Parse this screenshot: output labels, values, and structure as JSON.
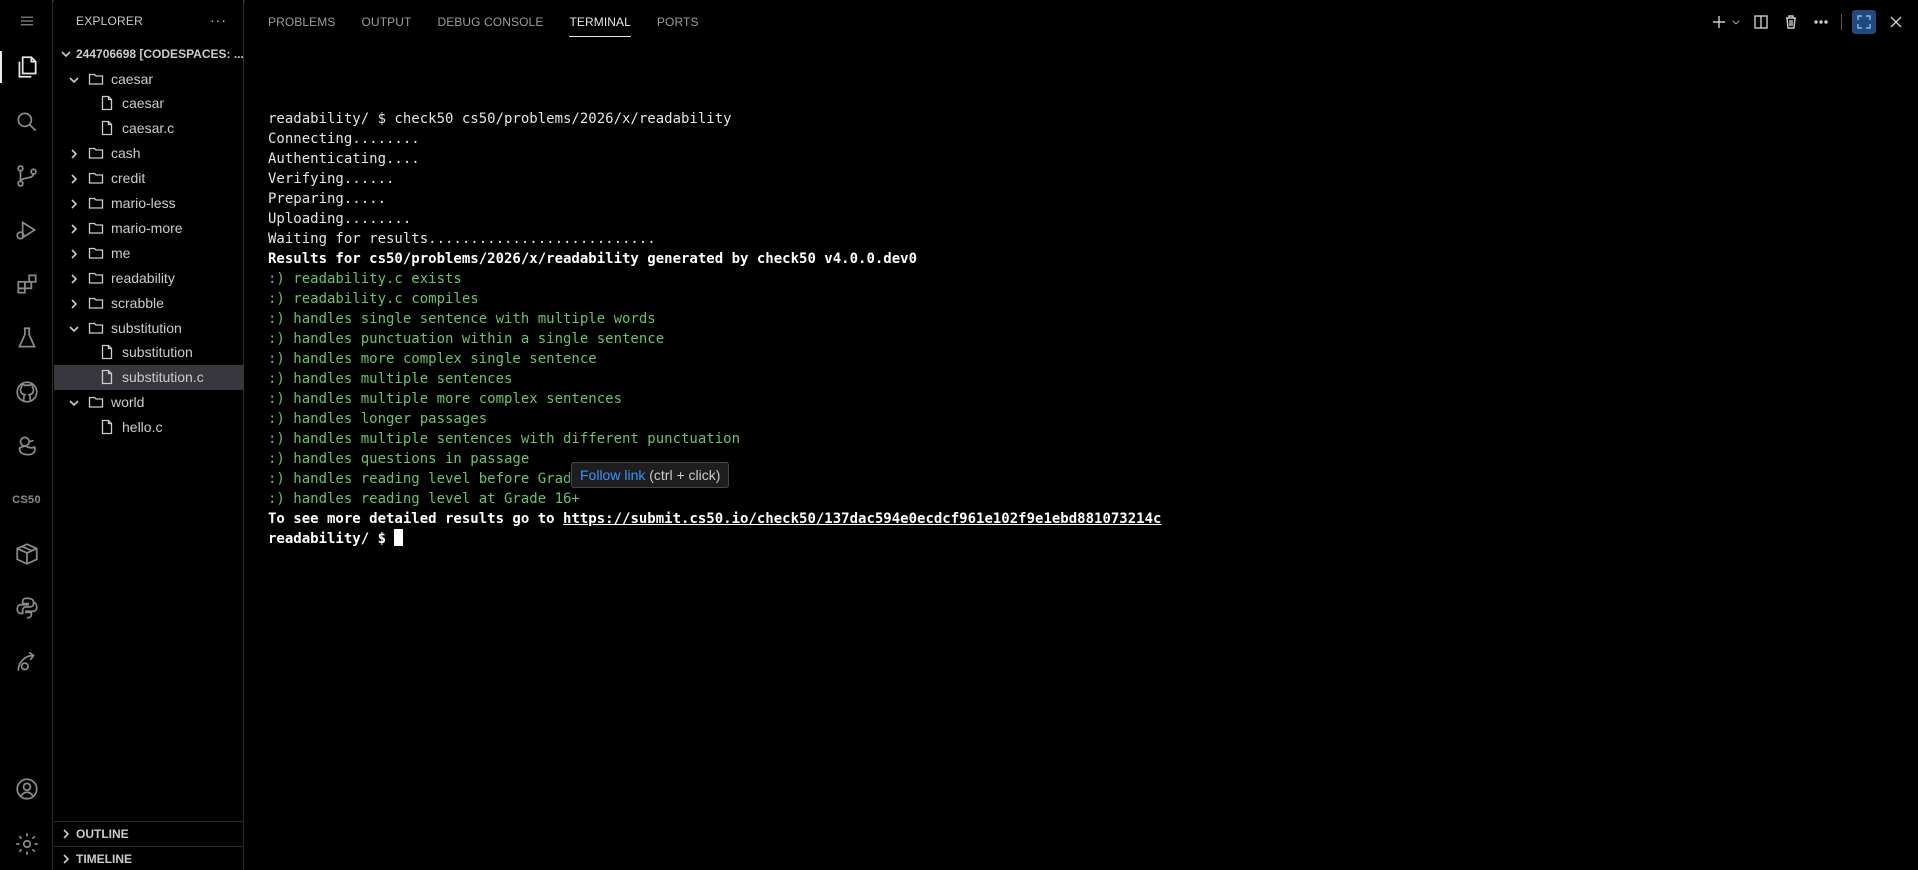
{
  "sidebar": {
    "title": "EXPLORER",
    "more": "···",
    "workspace": "244706698 [CODESPACES: ...",
    "items": [
      {
        "label": "caesar",
        "kind": "folder",
        "open": true,
        "depth": 0
      },
      {
        "label": "caesar",
        "kind": "file",
        "depth": 1
      },
      {
        "label": "caesar.c",
        "kind": "file",
        "depth": 1
      },
      {
        "label": "cash",
        "kind": "folder",
        "open": false,
        "depth": 0
      },
      {
        "label": "credit",
        "kind": "folder",
        "open": false,
        "depth": 0
      },
      {
        "label": "mario-less",
        "kind": "folder",
        "open": false,
        "depth": 0
      },
      {
        "label": "mario-more",
        "kind": "folder",
        "open": false,
        "depth": 0
      },
      {
        "label": "me",
        "kind": "folder",
        "open": false,
        "depth": 0
      },
      {
        "label": "readability",
        "kind": "folder",
        "open": false,
        "depth": 0
      },
      {
        "label": "scrabble",
        "kind": "folder",
        "open": false,
        "depth": 0
      },
      {
        "label": "substitution",
        "kind": "folder",
        "open": true,
        "depth": 0
      },
      {
        "label": "substitution",
        "kind": "file",
        "depth": 1
      },
      {
        "label": "substitution.c",
        "kind": "file",
        "depth": 1,
        "selected": true
      },
      {
        "label": "world",
        "kind": "folder",
        "open": true,
        "depth": 0
      },
      {
        "label": "hello.c",
        "kind": "file",
        "depth": 1
      }
    ],
    "outline": "OUTLINE",
    "timeline": "TIMELINE"
  },
  "activity_bar": {
    "cs50_label": "CS50"
  },
  "panel": {
    "tabs": [
      "PROBLEMS",
      "OUTPUT",
      "DEBUG CONSOLE",
      "TERMINAL",
      "PORTS"
    ],
    "active_tab": "TERMINAL"
  },
  "terminal": {
    "lines": [
      {
        "text": "",
        "style": "plain"
      },
      {
        "text": "readability/ $ check50 cs50/problems/2026/x/readability",
        "style": "plain"
      },
      {
        "text": "Connecting........",
        "style": "plain"
      },
      {
        "text": "Authenticating....",
        "style": "plain"
      },
      {
        "text": "Verifying......",
        "style": "plain"
      },
      {
        "text": "Preparing.....",
        "style": "plain"
      },
      {
        "text": "Uploading........",
        "style": "plain"
      },
      {
        "text": "Waiting for results...........................",
        "style": "plain"
      },
      {
        "text": "Results for cs50/problems/2026/x/readability generated by check50 v4.0.0.dev0",
        "style": "bold"
      },
      {
        "text": ":) readability.c exists",
        "style": "green"
      },
      {
        "text": ":) readability.c compiles",
        "style": "green"
      },
      {
        "text": ":) handles single sentence with multiple words",
        "style": "green"
      },
      {
        "text": ":) handles punctuation within a single sentence",
        "style": "green"
      },
      {
        "text": ":) handles more complex single sentence",
        "style": "green"
      },
      {
        "text": ":) handles multiple sentences",
        "style": "green"
      },
      {
        "text": ":) handles multiple more complex sentences",
        "style": "green"
      },
      {
        "text": ":) handles longer passages",
        "style": "green"
      },
      {
        "text": ":) handles multiple sentences with different punctuation",
        "style": "green"
      },
      {
        "text": ":) handles questions in passage",
        "style": "green"
      },
      {
        "text": ":) handles reading level before Grade 1",
        "style": "green"
      },
      {
        "text": ":) handles reading level at Grade 16+",
        "style": "green"
      }
    ],
    "results_prefix": "To see more detailed results go to ",
    "results_link": "https://submit.cs50.io/check50/137dac594e0ecdcf961e102f9e1ebd881073214c",
    "prompt": "readability/ $ "
  },
  "tooltip": {
    "link_text": "Follow link",
    "hint": " (ctrl + click)"
  }
}
